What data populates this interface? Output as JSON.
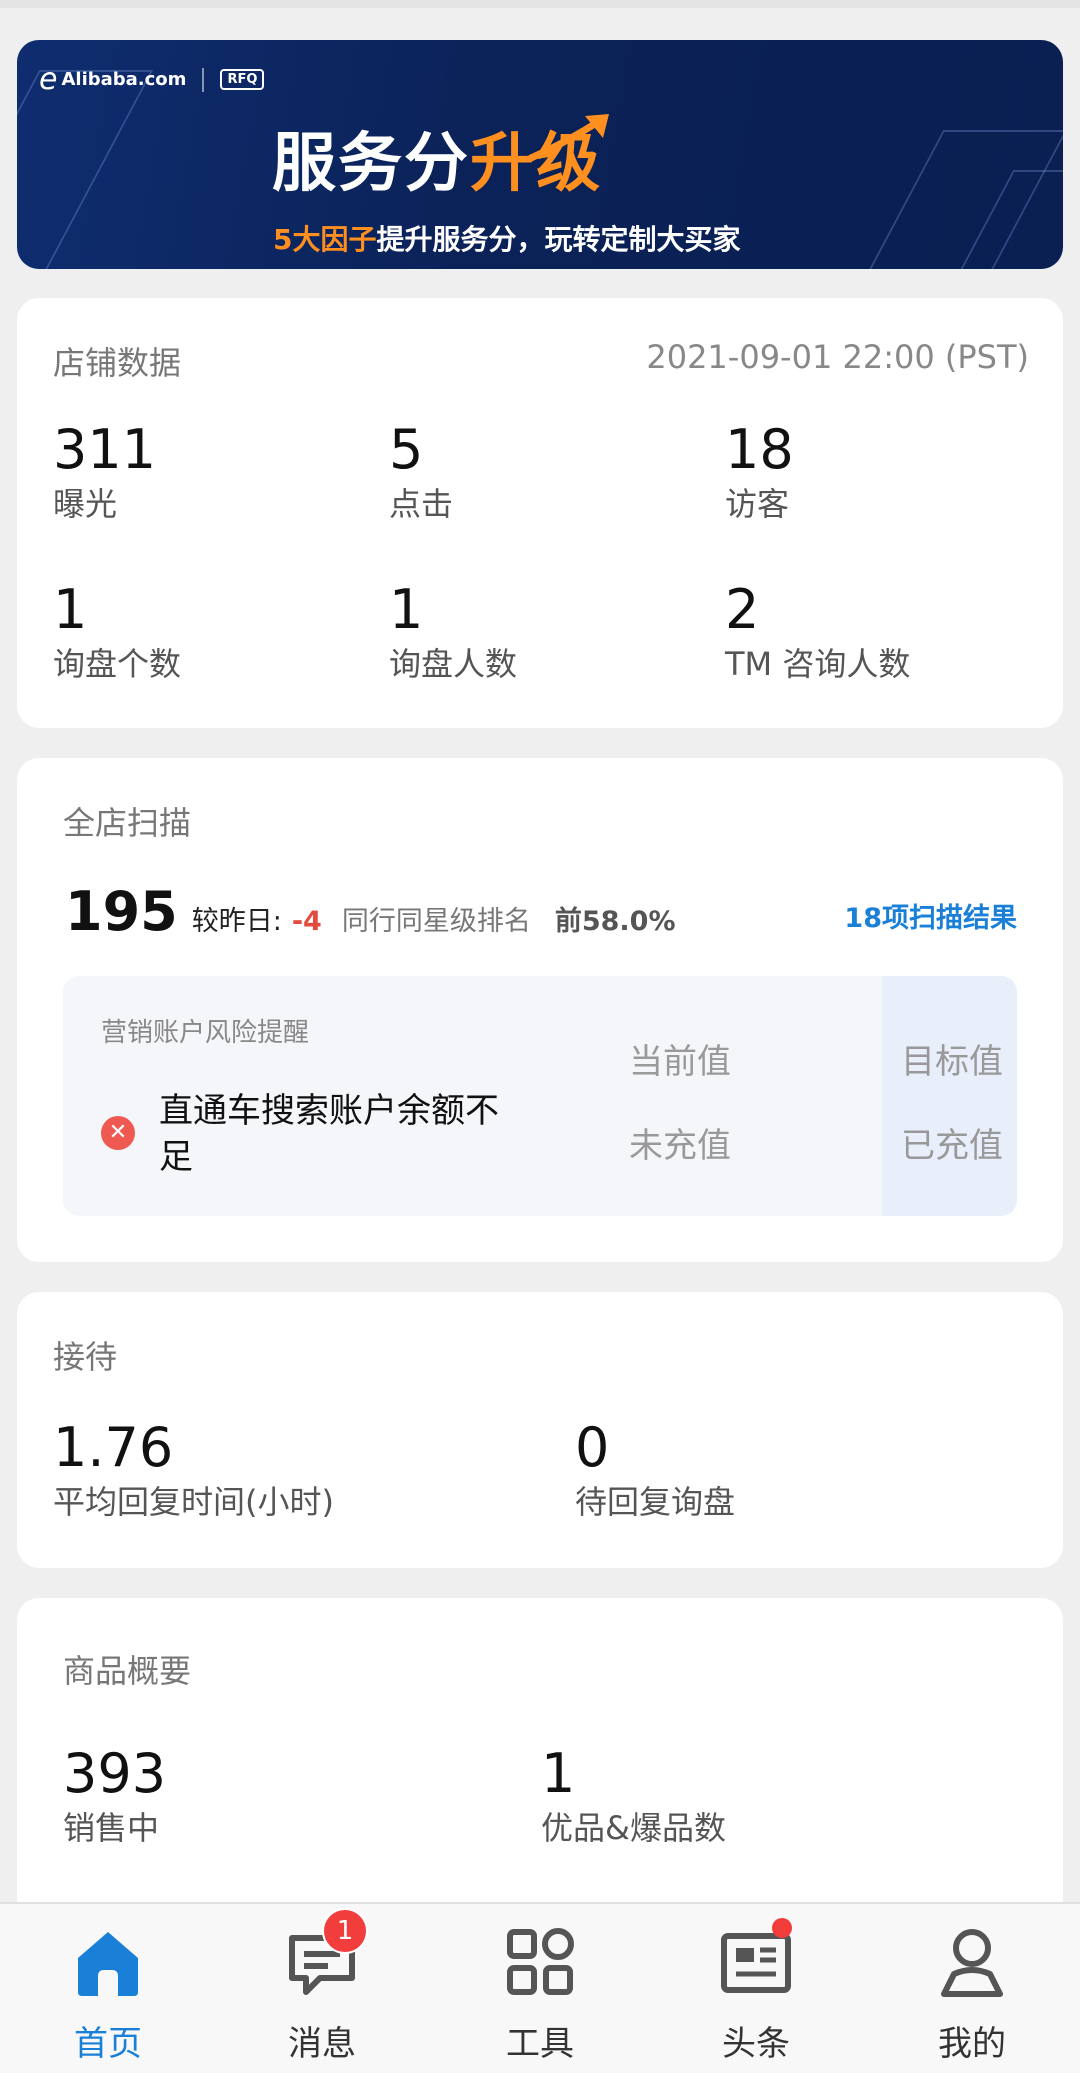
{
  "banner": {
    "brand": "Alibaba.com",
    "rfq": "RFQ",
    "headline_main": "服务分",
    "headline_highlight": "升级",
    "sub_highlight": "5大因子",
    "sub_rest": "提升服务分，玩转定制大买家"
  },
  "store": {
    "title": "店铺数据",
    "timestamp": "2021-09-01 22:00 (PST)",
    "stats": [
      {
        "value": "311",
        "label": "曝光"
      },
      {
        "value": "5",
        "label": "点击"
      },
      {
        "value": "18",
        "label": "访客"
      },
      {
        "value": "1",
        "label": "询盘个数"
      },
      {
        "value": "1",
        "label": "询盘人数"
      },
      {
        "value": "2",
        "label": "TM 咨询人数"
      }
    ]
  },
  "scan": {
    "title": "全店扫描",
    "score": "195",
    "compare_label": "较昨日:",
    "compare_value": "-4",
    "rank_label": "同行同星级排名",
    "rank_value": "前58.0%",
    "result_link": "18项扫描结果",
    "risk": {
      "title": "营销账户风险提醒",
      "col_current": "当前值",
      "col_target": "目标值",
      "item": "直通车搜索账户余额不足",
      "current_value": "未充值",
      "target_value": "已充值"
    }
  },
  "reception": {
    "title": "接待",
    "stats": [
      {
        "value": "1.76",
        "label": "平均回复时间(小时)"
      },
      {
        "value": "0",
        "label": "待回复询盘"
      }
    ]
  },
  "products": {
    "title": "商品概要",
    "stats": [
      {
        "value": "393",
        "label": "销售中"
      },
      {
        "value": "1",
        "label": "优品&爆品数"
      }
    ]
  },
  "nav": {
    "items": [
      {
        "label": "首页",
        "icon": "home-icon"
      },
      {
        "label": "消息",
        "icon": "message-icon",
        "badge": "1"
      },
      {
        "label": "工具",
        "icon": "grid-icon"
      },
      {
        "label": "头条",
        "icon": "news-icon"
      },
      {
        "label": "我的",
        "icon": "profile-icon"
      }
    ]
  },
  "colors": {
    "accent": "#1a7fd6",
    "danger": "#e34b3f",
    "banner_bg": "#0b2258",
    "banner_highlight": "#ff8f1f"
  }
}
